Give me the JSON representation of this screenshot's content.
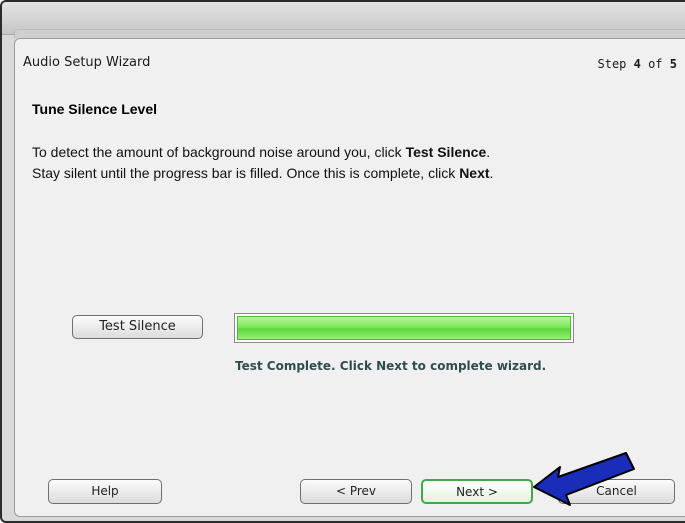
{
  "wizard": {
    "title": "Audio Setup Wizard",
    "step_prefix": "Step ",
    "step_current": "4",
    "step_of": " of ",
    "step_total": "5"
  },
  "section": {
    "title": "Tune Silence Level",
    "line1_pre": "To detect the amount of background noise around you, click ",
    "line1_bold": "Test Silence",
    "line1_post": ".",
    "line2_pre": "Stay silent until the progress bar is filled. Once this is complete, click ",
    "line2_bold": "Next",
    "line2_post": "."
  },
  "test": {
    "button_label": "Test Silence",
    "progress_percent": 100,
    "status_text": "Test Complete. Click Next to complete wizard."
  },
  "footer": {
    "help_label": "Help",
    "prev_label": "< Prev",
    "next_label": "Next >",
    "cancel_label": "Cancel"
  },
  "colors": {
    "progress_fill": "#7ee85c",
    "next_border": "#3fa84a",
    "arrow_fill": "#1a2db8",
    "status_text": "#2f4d4d"
  },
  "icons": {
    "annotation_arrow": "arrow-pointing-to-next-icon"
  }
}
